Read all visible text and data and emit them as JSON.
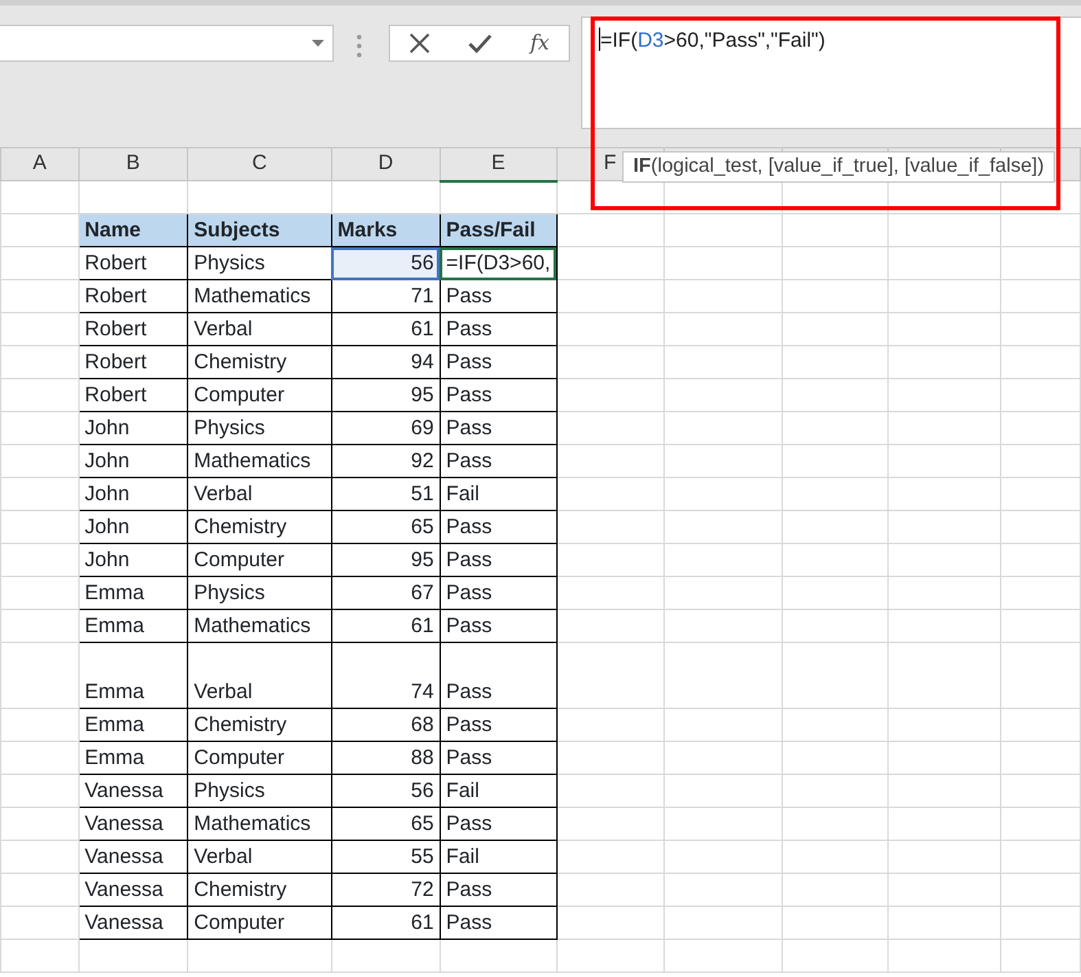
{
  "formula_bar": {
    "function_label": "fx",
    "parts": [
      {
        "text": "=IF(",
        "kind": "plain"
      },
      {
        "text": "D3",
        "kind": "ref"
      },
      {
        "text": ">60,\"Pass\",\"Fail\")",
        "kind": "plain"
      }
    ]
  },
  "tooltip": "**IF**(logical_test, [value_if_true], [value_if_false])",
  "columns": [
    {
      "label": "A",
      "selected": false
    },
    {
      "label": "B",
      "selected": false
    },
    {
      "label": "C",
      "selected": false
    },
    {
      "label": "D",
      "selected": false
    },
    {
      "label": "E",
      "selected": true
    },
    {
      "label": "F",
      "selected": false
    }
  ],
  "table": {
    "columns": [
      "Name",
      "Subjects",
      "Marks",
      "Pass/Fail"
    ],
    "rows": [
      {
        "cells": [
          "Robert",
          "Physics",
          "56",
          "=IF(D3>60,"
        ],
        "tall": false,
        "referenced": true,
        "editing": true
      },
      {
        "cells": [
          "Robert",
          "Mathematics",
          "71",
          "Pass"
        ],
        "tall": false,
        "referenced": false,
        "editing": false
      },
      {
        "cells": [
          "Robert",
          "Verbal",
          "61",
          "Pass"
        ],
        "tall": false,
        "referenced": false,
        "editing": false
      },
      {
        "cells": [
          "Robert",
          "Chemistry",
          "94",
          "Pass"
        ],
        "tall": false,
        "referenced": false,
        "editing": false
      },
      {
        "cells": [
          "Robert",
          "Computer",
          "95",
          "Pass"
        ],
        "tall": false,
        "referenced": false,
        "editing": false
      },
      {
        "cells": [
          "John",
          "Physics",
          "69",
          "Pass"
        ],
        "tall": false,
        "referenced": false,
        "editing": false
      },
      {
        "cells": [
          "John",
          "Mathematics",
          "92",
          "Pass"
        ],
        "tall": false,
        "referenced": false,
        "editing": false
      },
      {
        "cells": [
          "John",
          "Verbal",
          "51",
          "Fail"
        ],
        "tall": false,
        "referenced": false,
        "editing": false
      },
      {
        "cells": [
          "John",
          "Chemistry",
          "65",
          "Pass"
        ],
        "tall": false,
        "referenced": false,
        "editing": false
      },
      {
        "cells": [
          "John",
          "Computer",
          "95",
          "Pass"
        ],
        "tall": false,
        "referenced": false,
        "editing": false
      },
      {
        "cells": [
          "Emma",
          "Physics",
          "67",
          "Pass"
        ],
        "tall": false,
        "referenced": false,
        "editing": false
      },
      {
        "cells": [
          "Emma",
          "Mathematics",
          "61",
          "Pass"
        ],
        "tall": false,
        "referenced": false,
        "editing": false
      },
      {
        "cells": [
          "Emma",
          "Verbal",
          "74",
          "Pass"
        ],
        "tall": true,
        "referenced": false,
        "editing": false
      },
      {
        "cells": [
          "Emma",
          "Chemistry",
          "68",
          "Pass"
        ],
        "tall": false,
        "referenced": false,
        "editing": false
      },
      {
        "cells": [
          "Emma",
          "Computer",
          "88",
          "Pass"
        ],
        "tall": false,
        "referenced": false,
        "editing": false
      },
      {
        "cells": [
          "Vanessa",
          "Physics",
          "56",
          "Fail"
        ],
        "tall": false,
        "referenced": false,
        "editing": false
      },
      {
        "cells": [
          "Vanessa",
          "Mathematics",
          "65",
          "Pass"
        ],
        "tall": false,
        "referenced": false,
        "editing": false
      },
      {
        "cells": [
          "Vanessa",
          "Verbal",
          "55",
          "Fail"
        ],
        "tall": false,
        "referenced": false,
        "editing": false
      },
      {
        "cells": [
          "Vanessa",
          "Chemistry",
          "72",
          "Pass"
        ],
        "tall": false,
        "referenced": false,
        "editing": false
      },
      {
        "cells": [
          "Vanessa",
          "Computer",
          "61",
          "Pass"
        ],
        "tall": false,
        "referenced": false,
        "editing": false
      }
    ]
  }
}
